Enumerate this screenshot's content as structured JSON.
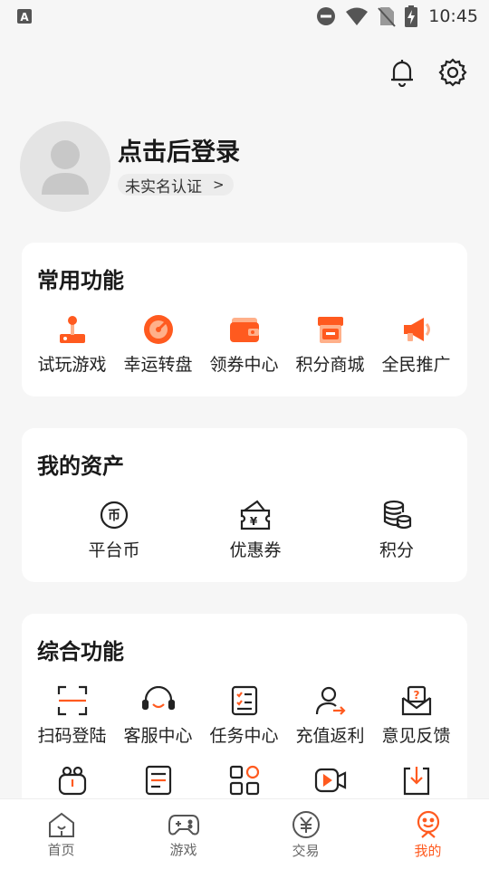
{
  "status_bar": {
    "time": "10:45"
  },
  "profile": {
    "login_text": "点击后登录",
    "verify_label": "未实名认证",
    "verify_arrow": ">"
  },
  "common": {
    "title": "常用功能",
    "items": [
      {
        "label": "试玩游戏",
        "icon": "joystick-icon"
      },
      {
        "label": "幸运转盘",
        "icon": "lucky-wheel-icon"
      },
      {
        "label": "领券中心",
        "icon": "wallet-coupon-icon"
      },
      {
        "label": "积分商城",
        "icon": "shop-icon"
      },
      {
        "label": "全民推广",
        "icon": "megaphone-icon"
      }
    ]
  },
  "assets": {
    "title": "我的资产",
    "items": [
      {
        "label": "平台币",
        "icon": "platform-coin-icon"
      },
      {
        "label": "优惠券",
        "icon": "coupon-icon"
      },
      {
        "label": "积分",
        "icon": "points-stack-icon"
      }
    ]
  },
  "general": {
    "title": "综合功能",
    "items": [
      {
        "label": "扫码登陆",
        "icon": "scan-icon"
      },
      {
        "label": "客服中心",
        "icon": "headset-icon"
      },
      {
        "label": "任务中心",
        "icon": "task-list-icon"
      },
      {
        "label": "充值返利",
        "icon": "recharge-rebate-icon"
      },
      {
        "label": "意见反馈",
        "icon": "feedback-icon"
      }
    ],
    "row2_icons": [
      "gift-icon",
      "document-icon",
      "apps-grid-icon",
      "video-icon",
      "download-icon"
    ]
  },
  "tabbar": {
    "items": [
      {
        "label": "首页",
        "icon": "home-icon"
      },
      {
        "label": "游戏",
        "icon": "gamepad-icon"
      },
      {
        "label": "交易",
        "icon": "yuan-icon"
      },
      {
        "label": "我的",
        "icon": "my-smile-icon",
        "active": true
      }
    ]
  },
  "colors": {
    "accent": "#ff5a1f",
    "accent_light": "#ffb08a",
    "background": "#f6f6f6"
  }
}
